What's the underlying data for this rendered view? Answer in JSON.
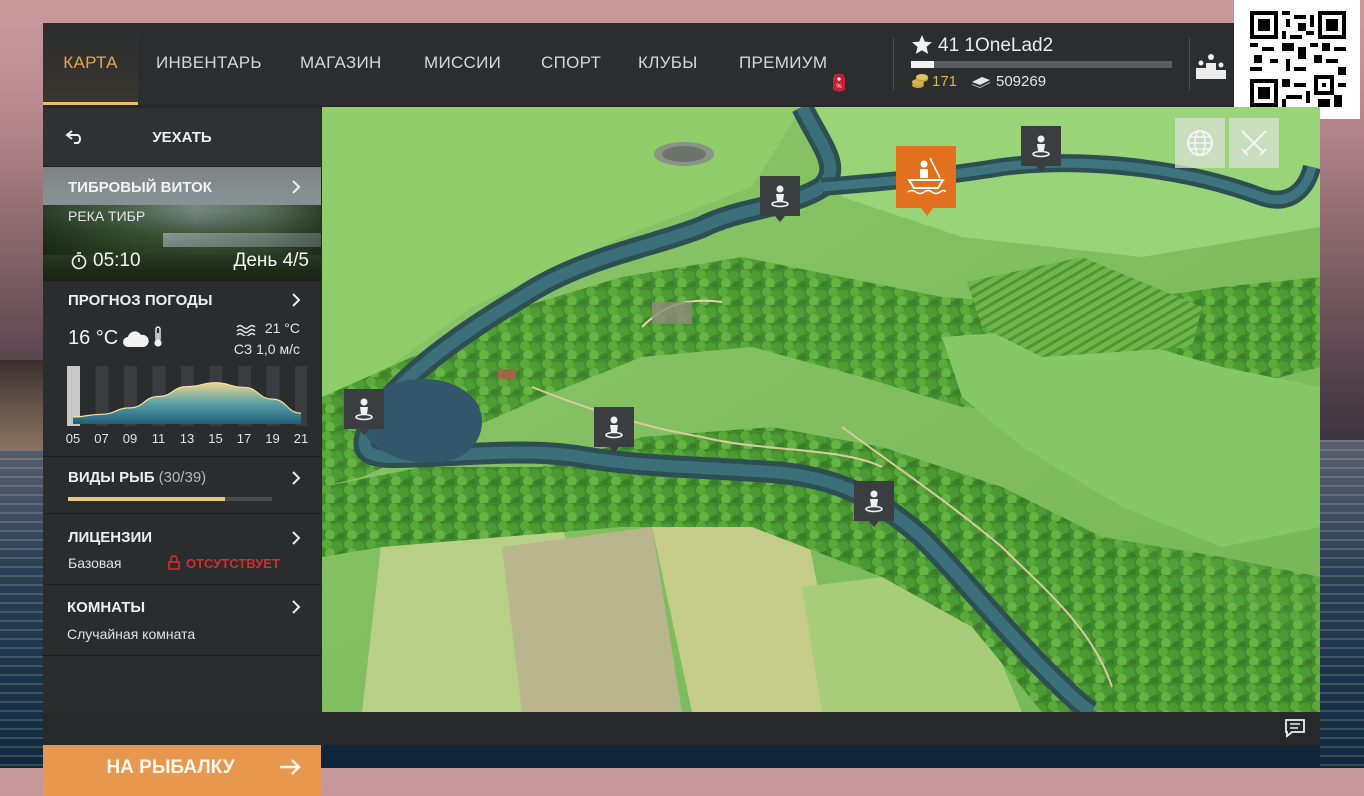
{
  "nav": {
    "tabs": [
      {
        "label": "КАРТА",
        "active": true
      },
      {
        "label": "ИНВЕНТАРЬ"
      },
      {
        "label": "МАГАЗИН"
      },
      {
        "label": "МИССИИ"
      },
      {
        "label": "СПОРТ"
      },
      {
        "label": "КЛУБЫ"
      },
      {
        "label": "ПРЕМИУМ"
      }
    ]
  },
  "player": {
    "level_name": "41 1OneLad2",
    "xp_progress": 0.09,
    "coins": "171",
    "cash": "509269"
  },
  "sidebar": {
    "leave_label": "УЕХАТЬ",
    "spot": {
      "title": "ТИБРОВЫЙ ВИТОК",
      "river": "РЕКА ТИБР",
      "time": "05:10",
      "day": "День 4/5"
    },
    "weather": {
      "title": "ПРОГНОЗ ПОГОДЫ",
      "air_temp": "16 °C",
      "water_temp": "21 °C",
      "wind": "СЗ 1,0 м/с",
      "hours": [
        "05",
        "07",
        "09",
        "11",
        "13",
        "15",
        "17",
        "19",
        "21"
      ],
      "current_hour_index": 0,
      "daylight_curve": [
        0.08,
        0.15,
        0.32,
        0.62,
        0.88,
        0.98,
        0.86,
        0.55,
        0.18
      ]
    },
    "fish": {
      "title": "ВИДЫ РЫБ",
      "count": "(30/39)",
      "progress": 0.77
    },
    "licenses": {
      "title": "ЛИЦЕНЗИИ",
      "type": "Базовая",
      "status": "ОТСУТСТВУЕТ"
    },
    "rooms": {
      "title": "КОМНАТЫ",
      "value": "Случайная комната"
    },
    "go_fishing_label": "НА РЫБАЛКУ"
  },
  "colors": {
    "accent_orange": "#e7974e",
    "active_tab": "#e9a44a",
    "selected_marker": "#e2711f",
    "alert_red": "#d12e2e",
    "coin_gold": "#d8b64f"
  },
  "icons": [
    "back-arrow-icon",
    "chevron-right-icon",
    "clock-icon",
    "cloud-icon",
    "thermometer-icon",
    "waves-icon",
    "lock-icon",
    "arrow-right-icon",
    "star-icon",
    "coins-icon",
    "cash-icon",
    "podium-icon",
    "fisherman-icon",
    "boat-icon",
    "globe-icon",
    "crossed-swords-icon",
    "chat-icon",
    "price-tag-icon"
  ]
}
